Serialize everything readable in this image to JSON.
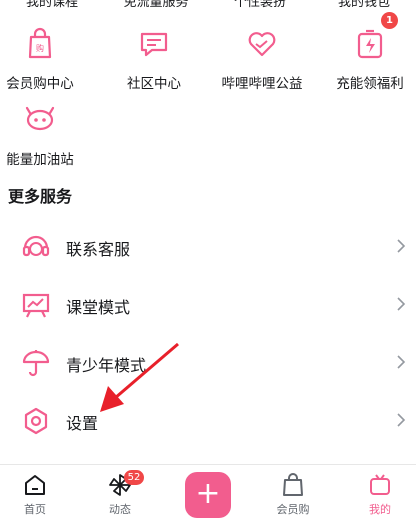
{
  "clipped_row": {
    "items": [
      "我的课程",
      "免流量服务",
      "个性装扮",
      "我的钱包"
    ]
  },
  "grid": {
    "items": [
      {
        "label": "会员购中心",
        "icon": "shopping-bag-icon"
      },
      {
        "label": "社区中心",
        "icon": "chat-bubble-icon"
      },
      {
        "label": "哔哩哔哩公益",
        "icon": "heart-charity-icon"
      },
      {
        "label": "充能领福利",
        "icon": "battery-gift-icon",
        "badge": "1"
      },
      {
        "label": "能量加油站",
        "icon": "energy-station-icon"
      }
    ]
  },
  "more_services": {
    "title": "更多服务",
    "items": [
      {
        "label": "联系客服",
        "icon": "headset-icon"
      },
      {
        "label": "课堂模式",
        "icon": "classroom-icon"
      },
      {
        "label": "青少年模式",
        "icon": "umbrella-icon"
      },
      {
        "label": "设置",
        "icon": "settings-icon"
      }
    ]
  },
  "tabbar": {
    "items": [
      {
        "label": "首页",
        "icon": "home-icon"
      },
      {
        "label": "动态",
        "icon": "pinwheel-icon",
        "badge": "52"
      },
      {
        "label": "会员购",
        "icon": "shopping-bag-icon"
      },
      {
        "label": "我的",
        "icon": "tv-icon"
      }
    ],
    "fab_label": "+"
  },
  "colors": {
    "accent": "#f25d8e",
    "badge": "#f04747",
    "arrow": "#e8202a"
  }
}
